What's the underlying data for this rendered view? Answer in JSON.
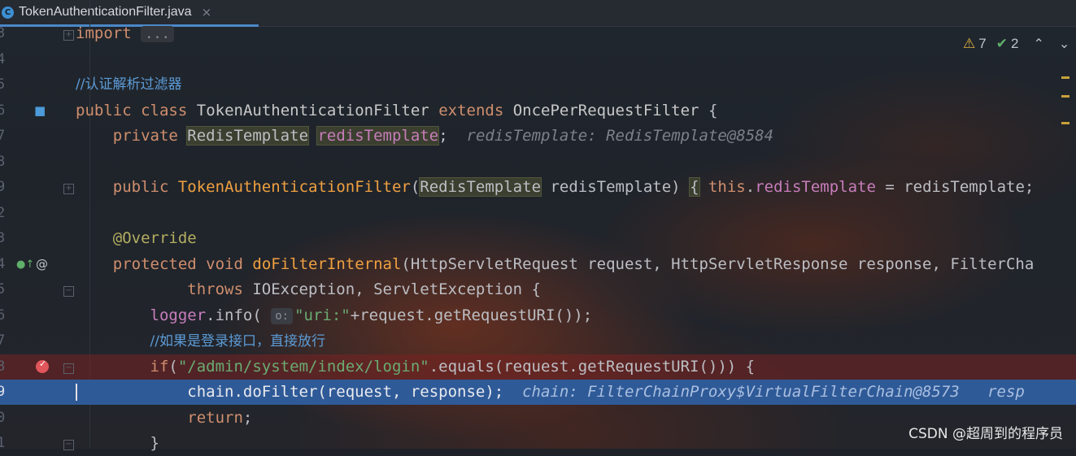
{
  "tab": {
    "icon": "C",
    "title": "TokenAuthenticationFilter.java",
    "close": "×"
  },
  "inspection": {
    "warnings": "7",
    "passed": "2",
    "warn_icon": "⚠",
    "ok_icon": "✔",
    "up_icon": "⌃",
    "down_icon": "⌄"
  },
  "watermark": "CSDN @超周到的程序员",
  "lines": {
    "l1": {
      "ln": "3",
      "import_kw": "import",
      "fold": "..."
    },
    "l2": {
      "ln": "4"
    },
    "l3": {
      "ln": "5",
      "comment": "//认证解析过滤器"
    },
    "l4": {
      "ln": "6",
      "public": "public",
      "class": "class",
      "name": "TokenAuthenticationFilter",
      "extends": "extends",
      "parent": "OncePerRequestFilter",
      "brace": "{"
    },
    "l5": {
      "ln": "7",
      "private": "private",
      "type": "RedisTemplate",
      "field": "redisTemplate",
      "semi": ";",
      "hint": "redisTemplate: RedisTemplate@8584"
    },
    "l6": {
      "ln": "8"
    },
    "l7": {
      "ln": "9",
      "public": "public",
      "name": "TokenAuthenticationFilter",
      "lparen": "(",
      "ptype": "RedisTemplate",
      "pname": " redisTemplate)",
      "lbrace": "{",
      "this": "this",
      "dot": ".",
      "field": "redisTemplate",
      "rest": " = redisTemplate;"
    },
    "l8": {
      "ln": "2"
    },
    "l9": {
      "ln": "3",
      "ann": "@Override"
    },
    "l10": {
      "ln": "4",
      "protected": "protected",
      "void": "void",
      "name": "doFilterInternal",
      "rest": "(HttpServletRequest request, HttpServletResponse response, FilterCha"
    },
    "l11": {
      "ln": "5",
      "throws": "throws",
      "rest": " IOException, ServletException {"
    },
    "l12": {
      "ln": "6",
      "logger": "logger",
      "call": ".info(",
      "badge": "o:",
      "str": "\"uri:\"",
      "rest": "+request.getRequestURI());"
    },
    "l13": {
      "ln": "7",
      "comment": "//如果是登录接口，直接放行"
    },
    "l14": {
      "ln": "8",
      "if": "if",
      "lp": "(",
      "str": "\"/admin/system/index/login\"",
      "rest": ".equals(request.getRequestURI())) {"
    },
    "l15": {
      "ln": "9",
      "code": "chain.doFilter(request, response);",
      "hint": "chain: FilterChainProxy$VirtualFilterChain@8573",
      "hint2": "resp"
    },
    "l16": {
      "ln": "0",
      "return": "return",
      "semi": ";"
    },
    "l17": {
      "ln": "1",
      "brace": "}"
    }
  },
  "gutter_icons": {
    "impl": "implemented-icon",
    "override": "override-icon",
    "at": "@",
    "breakpoint": "breakpoint-icon"
  }
}
